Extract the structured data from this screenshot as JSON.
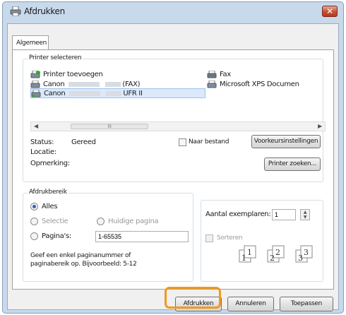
{
  "window": {
    "title": "Afdrukken",
    "close_label": "✕"
  },
  "tabs": [
    {
      "label": "Algemeen"
    }
  ],
  "printer_group": {
    "legend": "Printer selecteren",
    "printers": [
      {
        "name": "Printer toevoegen",
        "icon": "add-printer-icon"
      },
      {
        "name": "Canon",
        "suffix": "(FAX)",
        "icon": "printer-icon"
      },
      {
        "name": "Canon",
        "suffix": "UFR II",
        "icon": "printer-icon",
        "selected": true
      },
      {
        "name": "Fax",
        "icon": "fax-icon"
      },
      {
        "name": "Microsoft XPS Documen",
        "icon": "printer-icon"
      }
    ],
    "scroll_thumb": "III",
    "status_label": "Status:",
    "status_value": "Gereed",
    "location_label": "Locatie:",
    "comment_label": "Opmerking:",
    "print_to_file": "Naar bestand",
    "preferences_button": "Voorkeursinstellingen",
    "find_printer_button": "Printer zoeken..."
  },
  "range_group": {
    "legend": "Afdrukbereik",
    "all": "Alles",
    "selection": "Selectie",
    "current_page": "Huidige pagina",
    "pages": "Pagina's:",
    "pages_value": "1-65535",
    "hint_line1": "Geef een enkel paginanummer of",
    "hint_line2": "paginabereik op. Bijvoorbeeld: 5-12"
  },
  "copies_group": {
    "copies_label": "Aantal exemplaren:",
    "copies_value": "1",
    "collate_label": "Sorteren",
    "collate_pages": [
      "1",
      "1",
      "2",
      "2",
      "3",
      "3"
    ]
  },
  "buttons": {
    "print": "Afdrukken",
    "cancel": "Annuleren",
    "apply": "Toepassen"
  },
  "colors": {
    "highlight": "#f09a1a",
    "selection": "#dbe9fb",
    "window_frame": "#c9d9ec"
  }
}
